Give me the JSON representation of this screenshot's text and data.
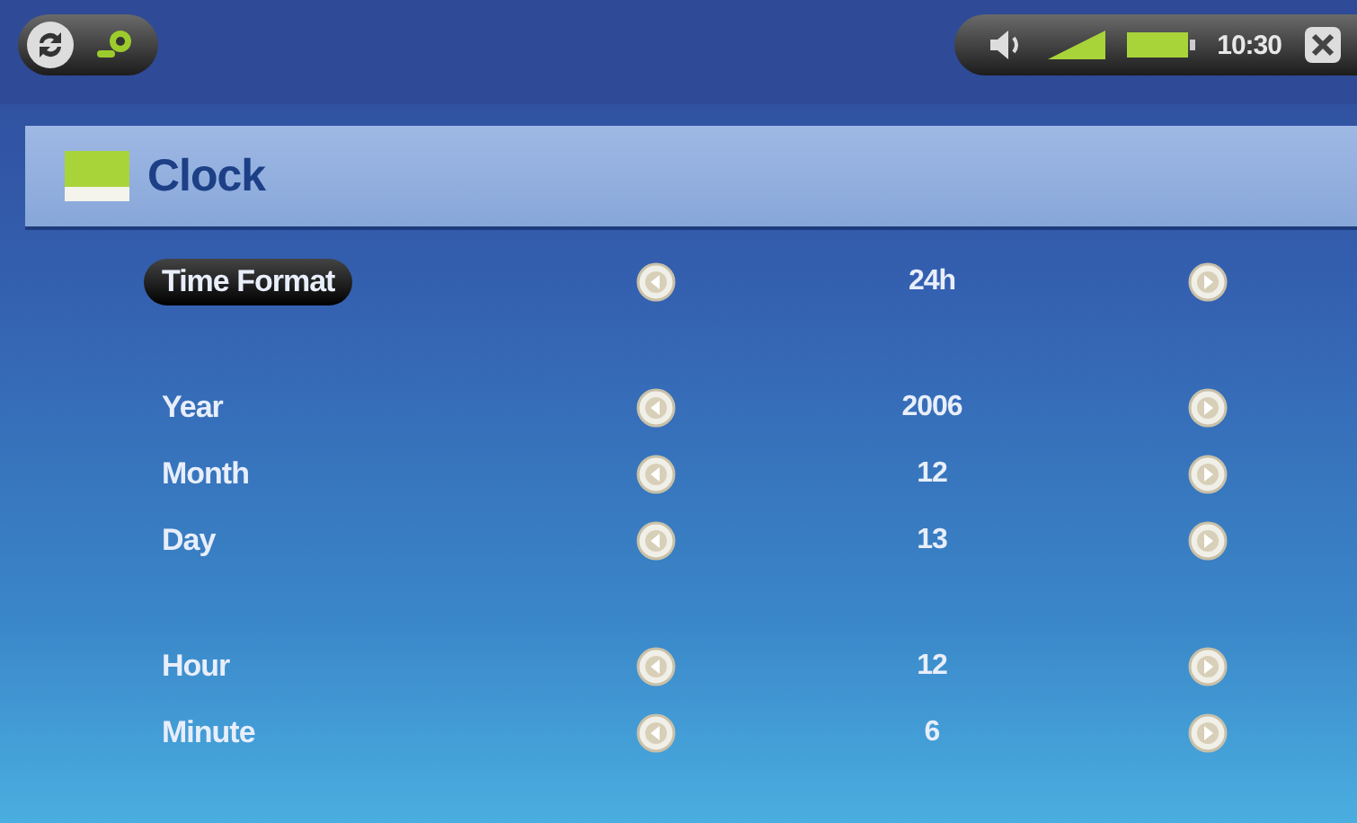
{
  "status_bar": {
    "time": "10:30"
  },
  "header": {
    "title": "Clock"
  },
  "groups": [
    {
      "rows": [
        {
          "label": "Time Format",
          "value": "24h",
          "selected": true
        }
      ]
    },
    {
      "rows": [
        {
          "label": "Year",
          "value": "2006",
          "selected": false
        },
        {
          "label": "Month",
          "value": "12",
          "selected": false
        },
        {
          "label": "Day",
          "value": "13",
          "selected": false
        }
      ]
    },
    {
      "rows": [
        {
          "label": "Hour",
          "value": "12",
          "selected": false
        },
        {
          "label": "Minute",
          "value": "6",
          "selected": false
        }
      ]
    }
  ]
}
